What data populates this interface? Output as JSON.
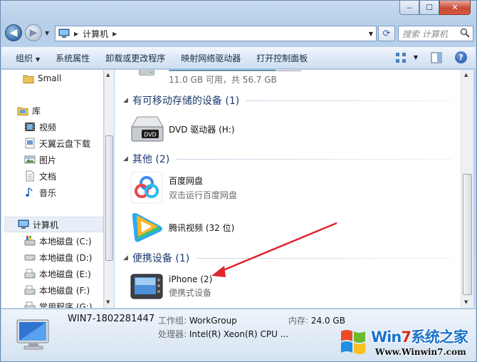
{
  "window": {
    "address_location": "计算机",
    "search_placeholder": "搜索 计算机",
    "caption": {
      "minimize": "‒",
      "maximize": "☐",
      "close": "✕"
    }
  },
  "toolbar": {
    "organize": "组织",
    "system_properties": "系统属性",
    "uninstall": "卸载或更改程序",
    "map_drive": "映射网络驱动器",
    "control_panel": "打开控制面板",
    "help": "?"
  },
  "navpane": {
    "items": [
      {
        "label": "Small",
        "icon": "folder-icon"
      },
      {
        "label": "库",
        "icon": "library-icon"
      },
      {
        "label": "视频",
        "icon": "video-icon"
      },
      {
        "label": "天翼云盘下载",
        "icon": "download-icon"
      },
      {
        "label": "图片",
        "icon": "picture-icon"
      },
      {
        "label": "文档",
        "icon": "document-icon"
      },
      {
        "label": "音乐",
        "icon": "music-icon"
      },
      {
        "label": "计算机",
        "icon": "computer-icon"
      },
      {
        "label": "本地磁盘 (C:)",
        "icon": "windows-drive-icon"
      },
      {
        "label": "本地磁盘 (D:)",
        "icon": "drive-icon"
      },
      {
        "label": "本地磁盘 (E:)",
        "icon": "drive-icon"
      },
      {
        "label": "本地磁盘 (F:)",
        "icon": "drive-icon"
      },
      {
        "label": "常用程序 (G:)",
        "icon": "drive-icon"
      }
    ]
  },
  "content": {
    "top_drive": {
      "space": "11.0 GB 可用，共 56.7 GB",
      "used_fraction": 0.81
    },
    "groups": [
      {
        "title": "有可移动存储的设备 (1)"
      },
      {
        "title": "其他 (2)"
      },
      {
        "title": "便携设备 (1)"
      }
    ],
    "dvd": {
      "title": "DVD 驱动器 (H:)",
      "icon_text": "DVD"
    },
    "baidu": {
      "title": "百度网盘",
      "subtitle": "双击运行百度网盘"
    },
    "tencent": {
      "title": "腾讯视频 (32 位)"
    },
    "iphone": {
      "title": "iPhone (2)",
      "subtitle": "便携式设备"
    }
  },
  "details": {
    "computer_name": "WIN7-1802281447",
    "workgroup_label": "工作组:",
    "workgroup_value": "WorkGroup",
    "memory_label": "内存:",
    "memory_value": "24.0 GB",
    "cpu_label": "处理器:",
    "cpu_value": "Intel(R) Xeon(R) CPU ..."
  },
  "watermark": {
    "title_prefix": "Win",
    "title_seven": "7",
    "title_rest": "系统之家",
    "url": "Www.Winwin7.com"
  },
  "colors": {
    "accent": "#1e3a6e",
    "drive_fill": "#1b86ad",
    "arrow": "#e0252d"
  }
}
